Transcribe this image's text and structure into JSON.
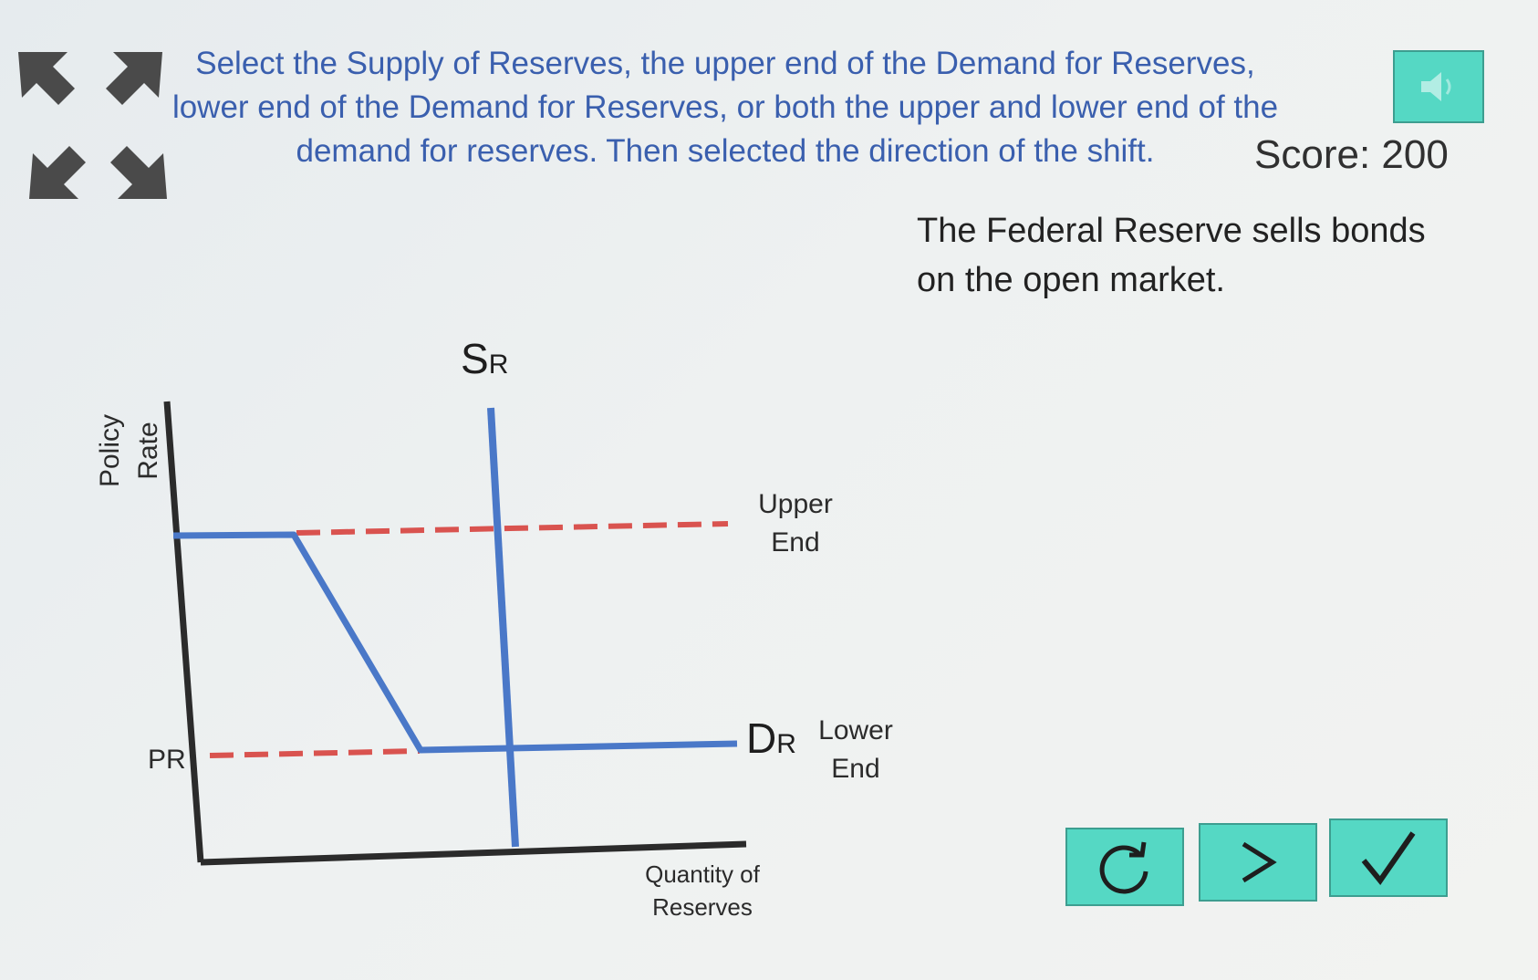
{
  "instructions": {
    "line1": "Select the Supply of Reserves, the upper end of the Demand for Reserves,",
    "line2": "lower end of the Demand for Reserves, or both the upper and lower end of the",
    "line3": "demand for reserves. Then selected the direction of the shift."
  },
  "score": {
    "label": "Score: 200"
  },
  "prompt": {
    "line1": "The Federal Reserve sells bonds",
    "line2": "on the open market."
  },
  "graph": {
    "y_axis_line1": "Policy",
    "y_axis_line2": "Rate",
    "pr_label": "PR",
    "supply_label_main": "S",
    "supply_label_sub": "R",
    "demand_label_main": "D",
    "demand_label_sub": "R",
    "upper_end_line1": "Upper",
    "upper_end_line2": "End",
    "lower_end_line1": "Lower",
    "lower_end_line2": "End",
    "x_axis_line1": "Quantity of",
    "x_axis_line2": "Reserves"
  },
  "buttons": {
    "sound_icon": "speaker-icon",
    "reset_icon": "reset-icon",
    "next_icon": "chevron-right-icon",
    "submit_icon": "check-icon"
  },
  "colors": {
    "instruction_text": "#3a5fae",
    "accent_button": "#55d8c4",
    "curve_blue": "#4a78c8",
    "dashed_red": "#d9534f",
    "arrow_grey": "#4a4a4a"
  }
}
